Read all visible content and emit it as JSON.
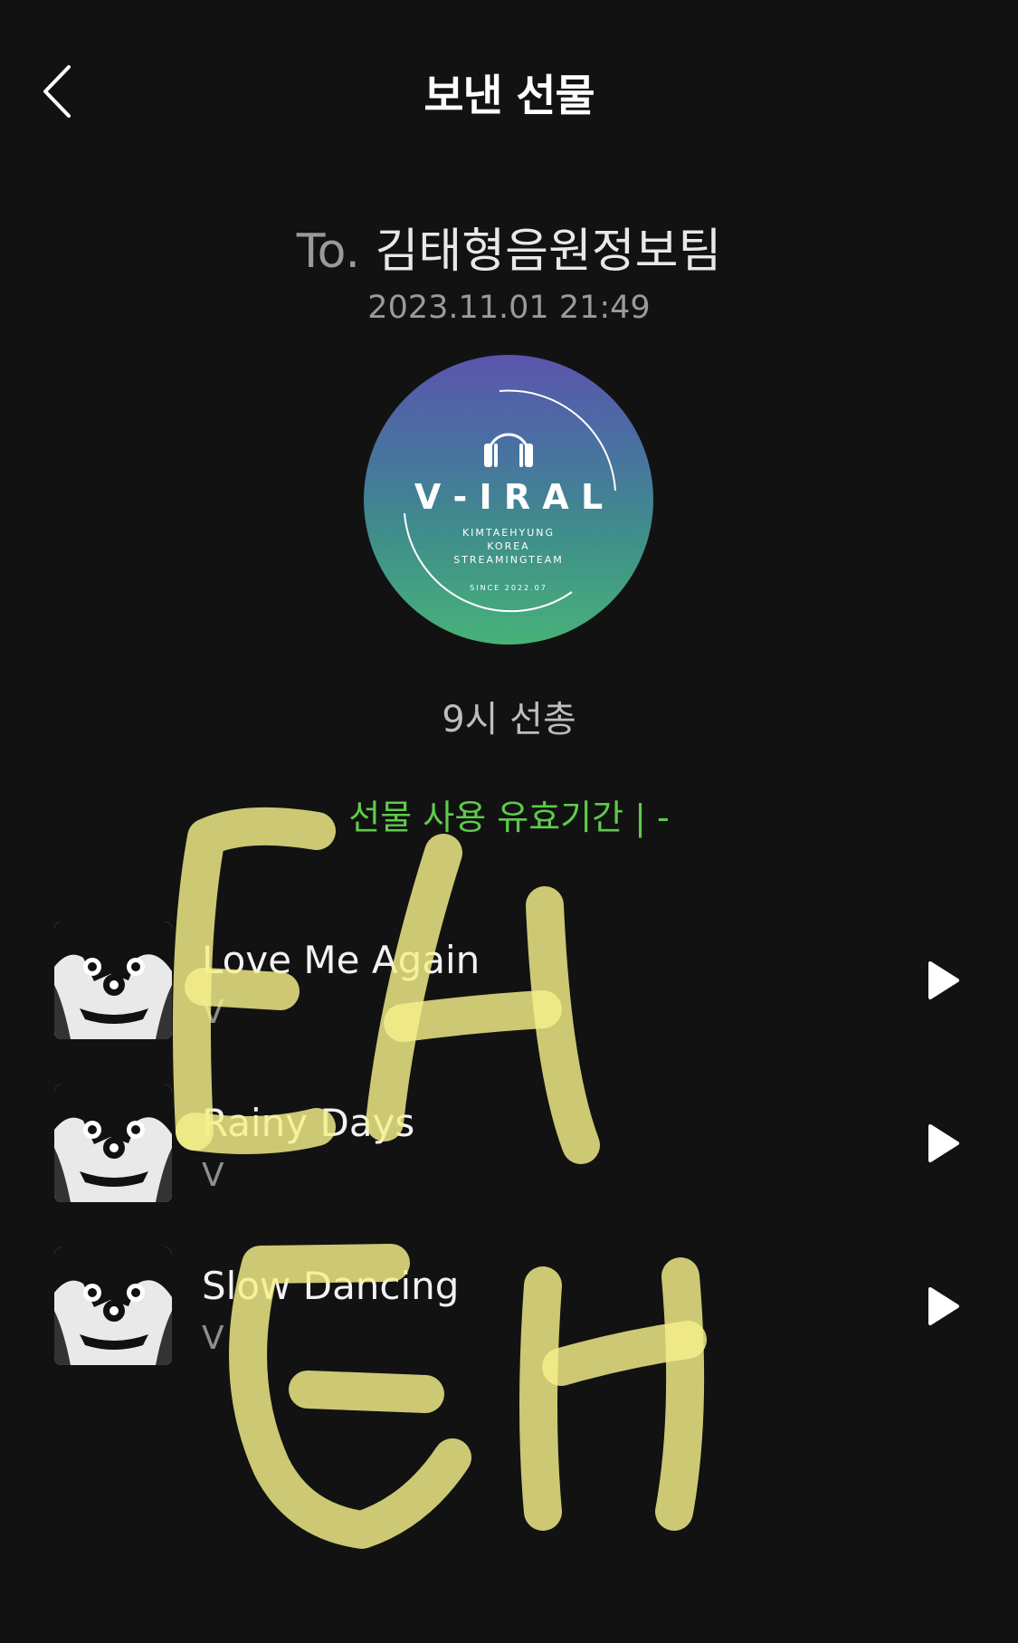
{
  "header": {
    "title": "보낸 선물",
    "back_icon": "chevron-left-icon"
  },
  "gift": {
    "to_prefix": "To.",
    "recipient": "김태형음원정보팀",
    "datetime": "2023.11.01 21:49",
    "message": "9시 선총",
    "validity_label": "선물 사용 유효기간  |   -"
  },
  "cover": {
    "title": "V - I R A L",
    "lines": [
      "KIMTAEHYUNG",
      "KOREA",
      "STREAMINGTEAM"
    ],
    "since": "SINCE 2022.07",
    "icon": "headphones-icon"
  },
  "tracks": [
    {
      "title": "Love Me Again",
      "artist": "V"
    },
    {
      "title": "Rainy Days",
      "artist": "V"
    },
    {
      "title": "Slow Dancing",
      "artist": "V"
    }
  ],
  "colors": {
    "background": "#121212",
    "accent": "#5ecb4b",
    "marker": "#f5f08a"
  }
}
